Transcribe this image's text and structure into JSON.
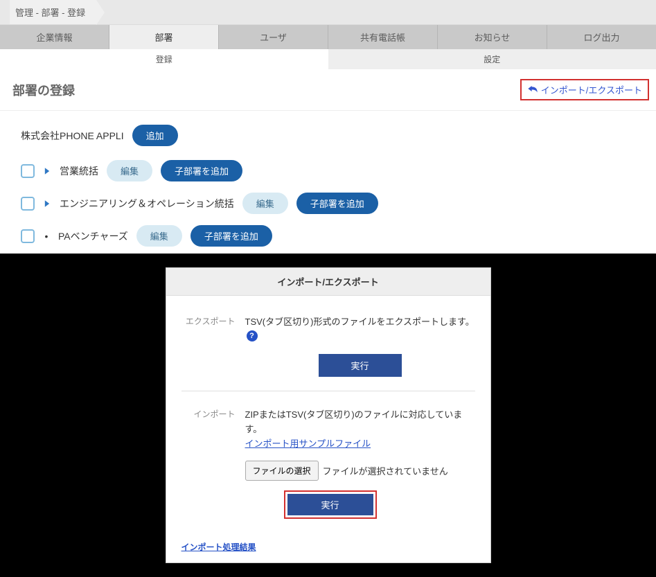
{
  "breadcrumb": "管理 - 部署 - 登録",
  "main_tabs": [
    "企業情報",
    "部署",
    "ユーザ",
    "共有電話帳",
    "お知らせ",
    "ログ出力"
  ],
  "main_tab_active": 1,
  "sub_tabs": [
    "登録",
    "設定"
  ],
  "sub_tab_active": 0,
  "page_title": "部署の登録",
  "import_export_link": "インポート/エクスポート",
  "company_name": "株式会社PHONE APPLI",
  "add_label": "追加",
  "edit_label": "編集",
  "add_child_label": "子部署を追加",
  "departments": [
    {
      "name": "営業統括",
      "expandable": true
    },
    {
      "name": "エンジニアリング＆オペレーション統括",
      "expandable": true
    },
    {
      "name": "PAベンチャーズ",
      "expandable": false
    }
  ],
  "modal": {
    "title": "インポート/エクスポート",
    "export": {
      "label": "エクスポート",
      "desc": "TSV(タブ区切り)形式のファイルをエクスポートします。",
      "exec": "実行"
    },
    "import": {
      "label": "インポート",
      "desc": "ZIPまたはTSV(タブ区切り)のファイルに対応しています。",
      "sample_link": "インポート用サンプルファイル",
      "file_button": "ファイルの選択",
      "file_status": "ファイルが選択されていません",
      "exec": "実行"
    },
    "result_link": "インポート処理結果"
  }
}
